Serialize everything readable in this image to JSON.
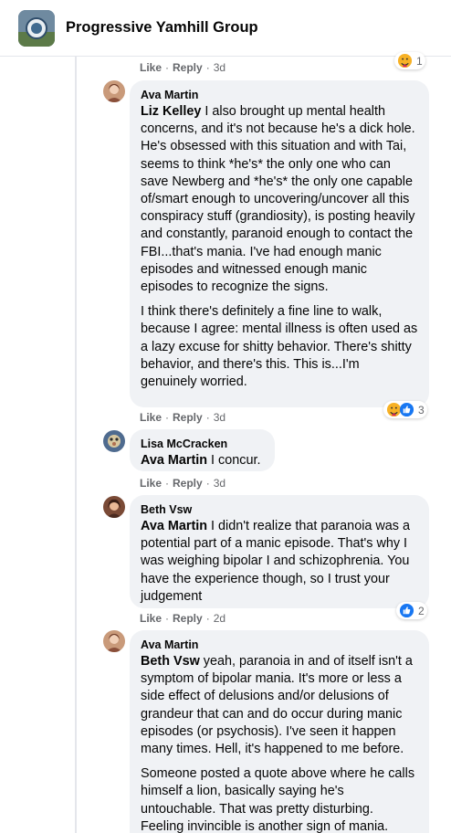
{
  "group": {
    "name": "Progressive Yamhill Group"
  },
  "actions": {
    "like": "Like",
    "reply": "Reply",
    "separator": "·"
  },
  "top": {
    "time": "3d",
    "reaction_count": "1"
  },
  "comments": [
    {
      "author": "Ava Martin",
      "mention": "Liz Kelley",
      "paragraphs": [
        " I also brought up mental health concerns, and it's not because he's a dick hole. He's obsessed with this situation and with Tai, seems to think *he's* the only one who can save Newberg and *he's* the only one capable of/smart enough to uncovering/uncover all this conspiracy stuff (grandiosity), is posting heavily and constantly, paranoid enough to contact the FBI...that's mania. I've had enough manic episodes and witnessed enough manic episodes to recognize the signs.",
        "I think there's definitely a fine line to walk, because I agree: mental illness is often used as a lazy excuse for shitty behavior. There's shitty behavior, and there's this. This is...I'm genuinely worried."
      ],
      "time": "3d",
      "reaction_count": "3",
      "reactions": [
        "care",
        "like"
      ]
    },
    {
      "author": "Lisa McCracken",
      "mention": "Ava Martin",
      "paragraphs": [
        " I concur."
      ],
      "time": "3d"
    },
    {
      "author": "Beth Vsw",
      "mention": "Ava Martin",
      "paragraphs": [
        " I didn't realize that paranoia was a potential part of a manic episode. That's why I was weighing bipolar I and schizophrenia. You have the experience though, so I trust your judgement"
      ],
      "time": "2d",
      "reaction_count": "2",
      "reactions": [
        "like"
      ]
    },
    {
      "author": "Ava Martin",
      "mention": "Beth Vsw",
      "paragraphs": [
        " yeah, paranoia in and of itself isn't a symptom of bipolar mania. It's more or less a side effect of delusions and/or delusions of grandeur that can and do occur during manic episodes (or psychosis). I've seen it happen many times. Hell, it's happened to me before.",
        "Someone posted a quote above where he calls himself a lion, basically saying he's untouchable. That was pretty disturbing. Feeling invincible is another sign of mania."
      ]
    }
  ],
  "colors": {
    "bubble": "#f0f2f5",
    "meta": "#65676b",
    "like_blue": "#1877f2",
    "care_yellow": "#f7b125"
  }
}
